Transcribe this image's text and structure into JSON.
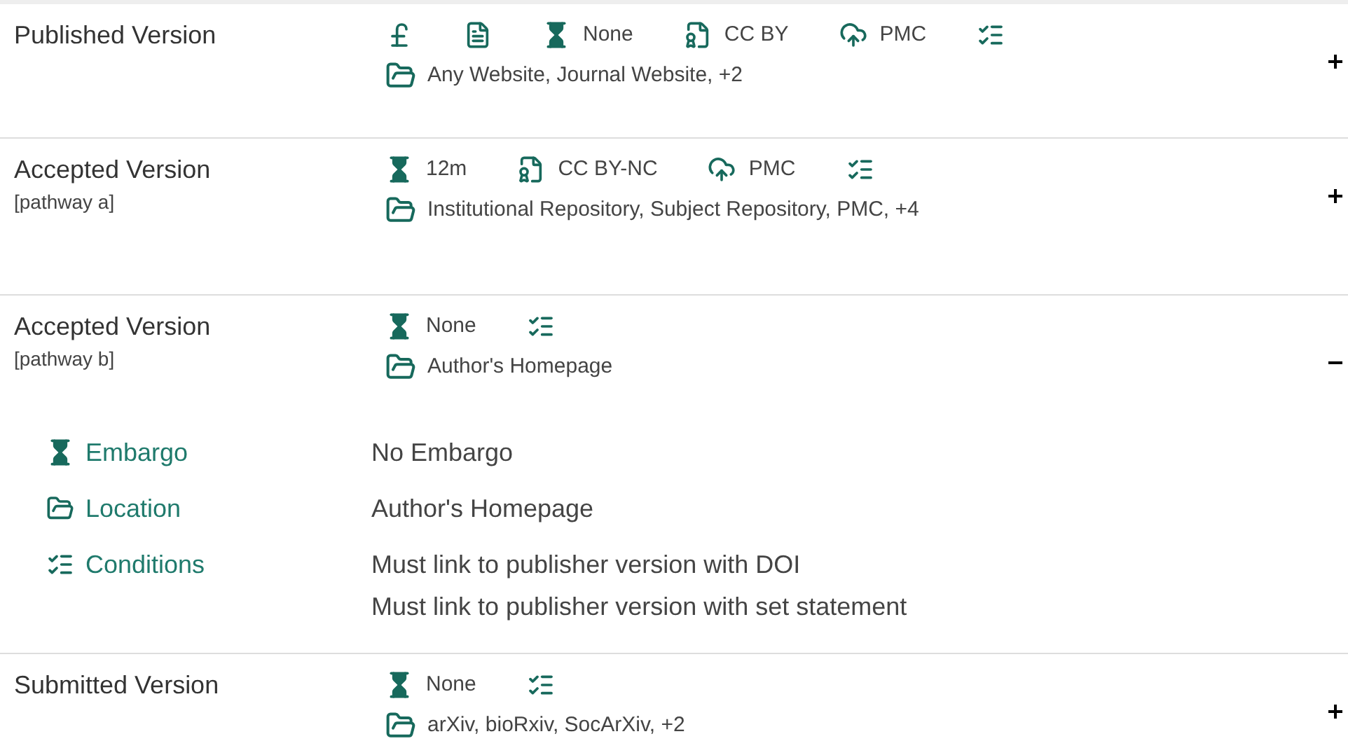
{
  "pathways": [
    {
      "title": "Published Version",
      "expanded": false,
      "summary": [
        {
          "kind": "fee"
        },
        {
          "kind": "article"
        },
        {
          "kind": "embargo",
          "text": "None"
        },
        {
          "kind": "license",
          "text": "CC BY"
        },
        {
          "kind": "repository",
          "text": "PMC"
        },
        {
          "kind": "conditions"
        }
      ],
      "locations": "Any Website, Journal Website, +2"
    },
    {
      "title": "Accepted Version",
      "subtitle": "[pathway a]",
      "expanded": false,
      "summary": [
        {
          "kind": "embargo",
          "text": "12m"
        },
        {
          "kind": "license",
          "text": "CC BY-NC"
        },
        {
          "kind": "repository",
          "text": "PMC"
        },
        {
          "kind": "conditions"
        }
      ],
      "locations": "Institutional Repository, Subject Repository, PMC, +4"
    },
    {
      "title": "Accepted Version",
      "subtitle": "[pathway b]",
      "expanded": true,
      "summary": [
        {
          "kind": "embargo",
          "text": "None"
        },
        {
          "kind": "conditions"
        }
      ],
      "locations": "Author's Homepage",
      "details": [
        {
          "kind": "embargo",
          "label": "Embargo",
          "values": [
            "No Embargo"
          ]
        },
        {
          "kind": "location",
          "label": "Location",
          "values": [
            "Author's Homepage"
          ]
        },
        {
          "kind": "conditions",
          "label": "Conditions",
          "values": [
            "Must link to publisher version with DOI",
            "Must link to publisher version with set statement"
          ]
        }
      ]
    },
    {
      "title": "Submitted Version",
      "expanded": false,
      "summary": [
        {
          "kind": "embargo",
          "text": "None"
        },
        {
          "kind": "conditions"
        }
      ],
      "locations": "arXiv, bioRxiv, SocArXiv, +2"
    }
  ]
}
